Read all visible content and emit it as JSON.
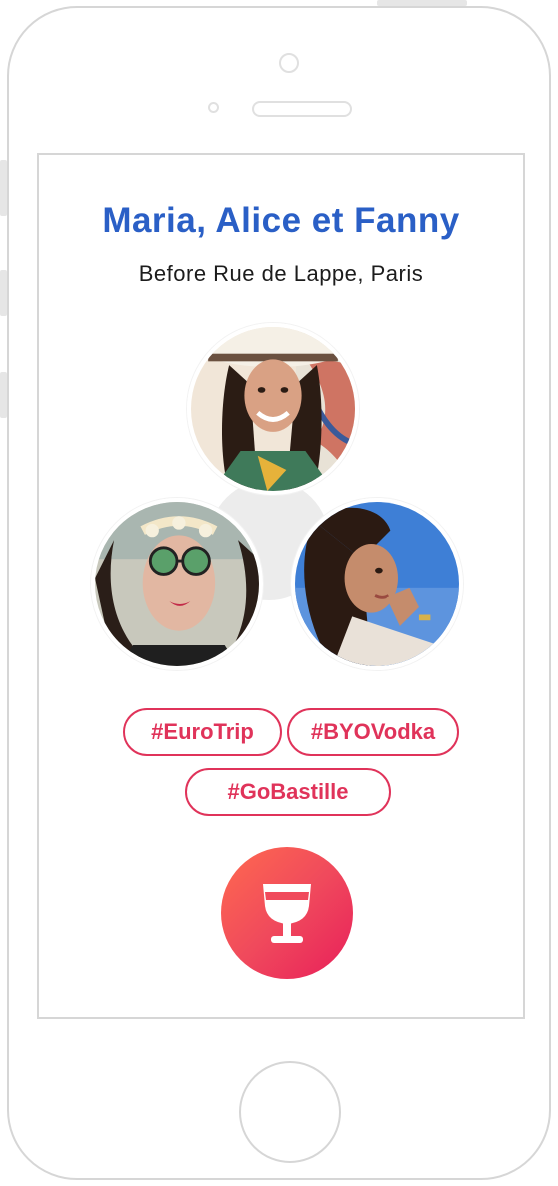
{
  "profile": {
    "names": "Maria, Alice et Fanny",
    "event": "Before Rue de Lappe, Paris"
  },
  "photos": [
    {
      "id": "maria",
      "name": "avatar-top"
    },
    {
      "id": "alice",
      "name": "avatar-left"
    },
    {
      "id": "fanny",
      "name": "avatar-right"
    }
  ],
  "tags": [
    "#EuroTrip",
    "#BYOVodka",
    "#GoBastille"
  ],
  "action": {
    "icon": "wine-glass-icon"
  },
  "colors": {
    "title": "#2a5fc6",
    "accent": "#e0335a",
    "gradient_start": "#ff6a4f",
    "gradient_end": "#e81f5a"
  }
}
